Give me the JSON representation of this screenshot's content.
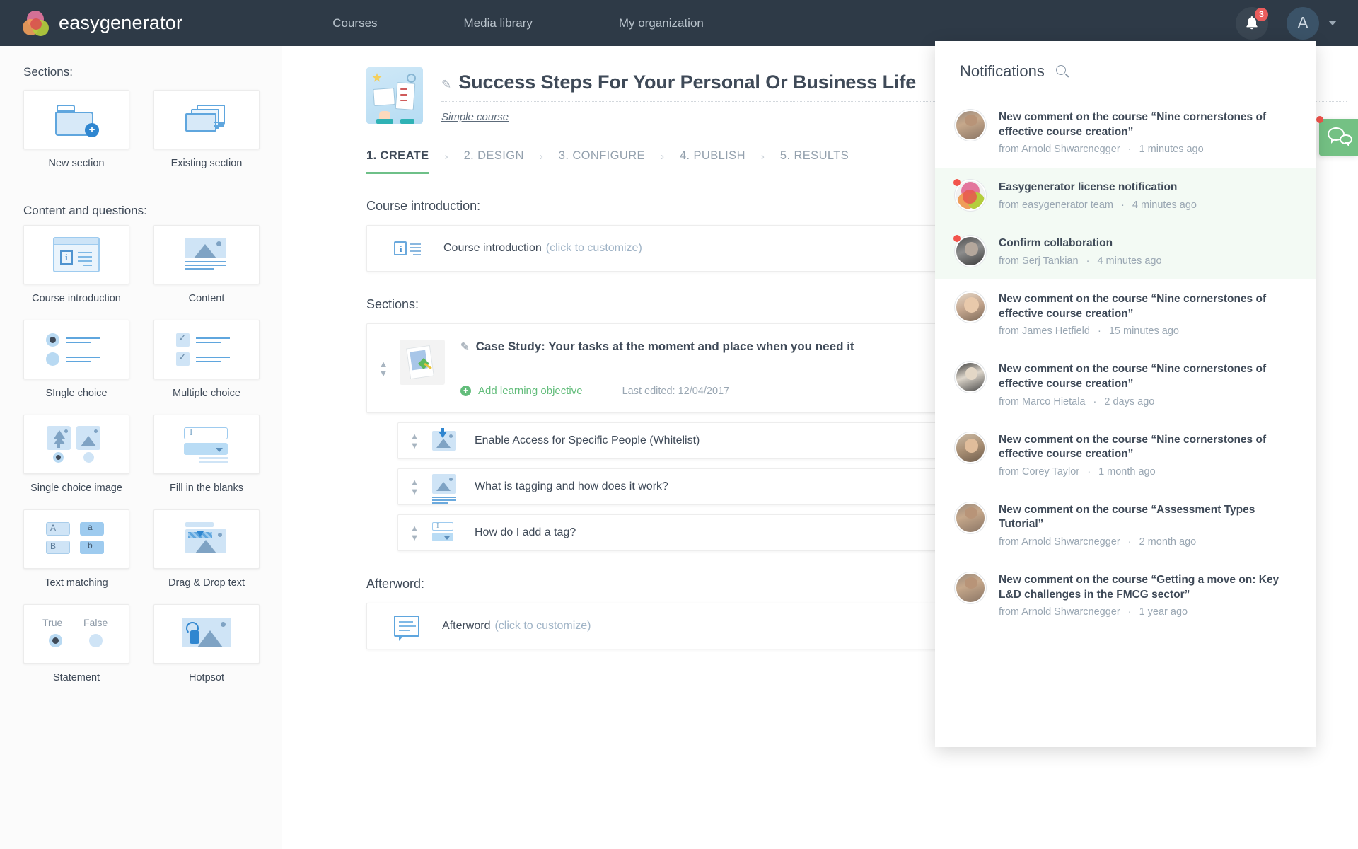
{
  "header": {
    "brand": "easygenerator",
    "brand_logo_icon": "easygenerator-logo-icon",
    "nav": [
      {
        "label": "Courses"
      },
      {
        "label": "Media library"
      },
      {
        "label": "My organization"
      }
    ],
    "bell_icon": "bell-icon",
    "notification_count": "3",
    "avatar_initial": "A",
    "chevron_icon": "chevron-down-icon"
  },
  "sidebar": {
    "sections_heading": "Sections:",
    "sections": [
      {
        "label": "New section",
        "icon": "new-folder-icon"
      },
      {
        "label": "Existing section",
        "icon": "existing-folders-icon"
      }
    ],
    "content_heading": "Content and questions:",
    "content_items": [
      {
        "label": "Course introduction",
        "icon": "course-introduction-icon"
      },
      {
        "label": "Content",
        "icon": "content-image-icon"
      },
      {
        "label": "SIngle choice",
        "icon": "single-choice-icon"
      },
      {
        "label": "Multiple choice",
        "icon": "multiple-choice-icon"
      },
      {
        "label": "Single choice image",
        "icon": "single-choice-image-icon"
      },
      {
        "label": "Fill in the blanks",
        "icon": "fill-in-blanks-icon"
      },
      {
        "label": "Text matching",
        "icon": "text-matching-icon"
      },
      {
        "label": "Drag & Drop text",
        "icon": "drag-drop-text-icon"
      },
      {
        "label": "Statement",
        "icon": "statement-icon"
      },
      {
        "label": "Hotpsot",
        "icon": "hotspot-icon"
      }
    ]
  },
  "course": {
    "thumbnail_icon": "course-thumbnail-icon",
    "edit_icon": "pencil-icon",
    "title": "Success Steps For Your Personal Or Business Life",
    "type": "Simple course",
    "steps": [
      {
        "label": "1. CREATE",
        "active": true
      },
      {
        "label": "2. DESIGN",
        "active": false
      },
      {
        "label": "3. CONFIGURE",
        "active": false
      },
      {
        "label": "4. PUBLISH",
        "active": false
      },
      {
        "label": "5. RESULTS",
        "active": false
      }
    ],
    "step_separator": "›"
  },
  "main": {
    "course_intro_label": "Course introduction:",
    "course_intro_row": {
      "text": "Course introduction",
      "hint": "(click to customize)",
      "icon": "info-lines-icon"
    },
    "sections_label": "Sections:",
    "section": {
      "edit_icon": "pencil-icon",
      "title": "Case Study: Your tasks at the moment and place when you need it",
      "add_objective": "Add learning objective",
      "add_objective_icon": "plus-circle-icon",
      "last_edited": "Last edited: 12/04/2017",
      "drag_icon": "drag-handle-icon",
      "thumbnail_icon": "section-thumbnail-icon"
    },
    "sub_rows": [
      {
        "text": "Enable Access for Specific People (Whitelist)",
        "icon": "image-download-icon"
      },
      {
        "text": "What is tagging and how does it work?",
        "icon": "content-image-icon"
      },
      {
        "text": "How do I add a tag?",
        "icon": "fill-in-blanks-icon"
      }
    ],
    "afterword_label": "Afterword:",
    "afterword_row": {
      "text": "Afterword",
      "hint": "(click to customize)",
      "icon": "afterword-icon"
    }
  },
  "notifications": {
    "title": "Notifications",
    "search_icon": "search-icon",
    "items": [
      {
        "text": "New comment on the course “Nine cornerstones of effective course creation”",
        "from": "from Arnold Shwarcnegger",
        "time": "1 minutes ago",
        "unread": false,
        "avatar": "arnold"
      },
      {
        "text": "Easygenerator license notification",
        "from": "from easygenerator team",
        "time": "4 minutes ago",
        "unread": true,
        "avatar": "eg"
      },
      {
        "text": "Confirm collaboration",
        "from": "from Serj Tankian",
        "time": "4 minutes ago",
        "unread": true,
        "avatar": "serj"
      },
      {
        "text": "New comment on the course “Nine cornerstones of effective course creation”",
        "from": "from James Hetfield",
        "time": "15 minutes ago",
        "unread": false,
        "avatar": "james"
      },
      {
        "text": "New comment on the course “Nine cornerstones of effective course creation”",
        "from": "from Marco Hietala",
        "time": "2 days ago",
        "unread": false,
        "avatar": "marco"
      },
      {
        "text": "New comment on the course “Nine cornerstones of effective course creation”",
        "from": "from Corey Taylor",
        "time": "1 month ago",
        "unread": false,
        "avatar": "corey"
      },
      {
        "text": "New comment on the course “Assessment Types Tutorial”",
        "from": "from Arnold Shwarcnegger",
        "time": "2 month ago",
        "unread": false,
        "avatar": "arnold"
      },
      {
        "text": "New comment on the course “Getting a move on: Key L&D challenges in the FMCG sector”",
        "from": "from Arnold Shwarcnegger",
        "time": "1 year ago",
        "unread": false,
        "avatar": "arnold"
      }
    ],
    "separator": "·"
  },
  "chat": {
    "icon": "chat-bubbles-icon",
    "has_notification": true
  },
  "colors": {
    "header_bg": "#2e3a47",
    "accent_green": "#6ec088",
    "badge_red": "#ea5c5c",
    "link_blue": "#5fa6de",
    "text_dark": "#3f4a58",
    "text_muted": "#9aa7b3"
  }
}
